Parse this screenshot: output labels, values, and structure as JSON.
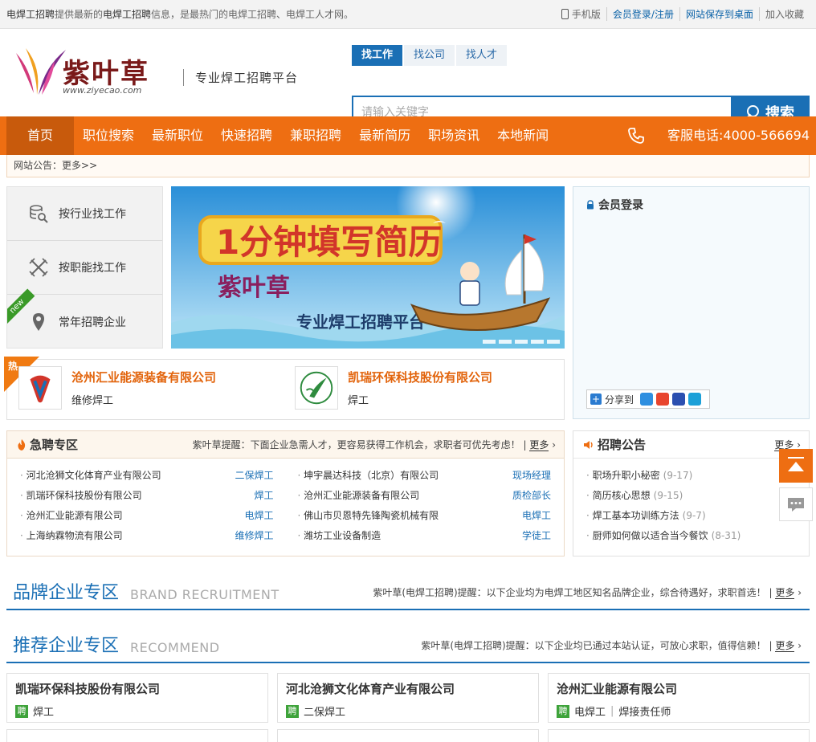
{
  "topbar": {
    "intro_bold1": "电焊工招聘",
    "intro_mid": "提供最新的",
    "intro_bold2": "电焊工招聘",
    "intro_rest": "信息，是最热门的电焊工招聘、电焊工人才网。",
    "mobile": "手机版",
    "login": "会员登录/注册",
    "save_desktop": "网站保存到桌面",
    "favorite": "加入收藏"
  },
  "header": {
    "logo_text": "紫叶草",
    "logo_url": "www.ziyecao.com",
    "slogan": "专业焊工招聘平台",
    "search_tabs": [
      "找工作",
      "找公司",
      "找人才"
    ],
    "search_placeholder": "请输入关键字",
    "search_button": "搜索"
  },
  "nav": {
    "items": [
      "首页",
      "职位搜索",
      "最新职位",
      "快速招聘",
      "兼职招聘",
      "最新简历",
      "职场资讯",
      "本地新闻"
    ],
    "hotline": "客服电话:4000-566694"
  },
  "notice": {
    "label": "网站公告：",
    "more": "更多>>"
  },
  "sidemenu": {
    "items": [
      "按行业找工作",
      "按职能找工作",
      "常年招聘企业"
    ],
    "new_label": "new"
  },
  "banner": {
    "headline": "1分钟填写简历",
    "brand": "紫叶草",
    "sub": "专业焊工招聘平台"
  },
  "login_box": {
    "title": "会员登录",
    "share": "分享到"
  },
  "hot": {
    "flag": "热",
    "companies": [
      {
        "name": "沧州汇业能源装备有限公司",
        "job": "维修焊工"
      },
      {
        "name": "凯瑞环保科技股份有限公司",
        "job": "焊工"
      }
    ]
  },
  "urgent": {
    "title": "急聘专区",
    "tip": "紫叶草提醒：下面企业急需人才，更容易获得工作机会，求职者可优先考虑！",
    "more": "更多",
    "left": [
      {
        "company": "河北沧狮文化体育产业有限公司",
        "job": "二保焊工"
      },
      {
        "company": "凯瑞环保科技股份有限公司",
        "job": "焊工"
      },
      {
        "company": "沧州汇业能源有限公司",
        "job": "电焊工"
      },
      {
        "company": "上海纳霖物流有限公司",
        "job": "维修焊工"
      }
    ],
    "right": [
      {
        "company": "坤宇晨达科技（北京）有限公司",
        "job": "现场经理"
      },
      {
        "company": "沧州汇业能源装备有限公司",
        "job": "质检部长"
      },
      {
        "company": "佛山市贝恩特先锋陶瓷机械有限",
        "job": "电焊工"
      },
      {
        "company": "潍坊工业设备制造",
        "job": "学徒工"
      }
    ]
  },
  "rnotice": {
    "title": "招聘公告",
    "more": "更多",
    "items": [
      {
        "title": "职场升职小秘密",
        "date": "(9-17)"
      },
      {
        "title": "简历核心思想",
        "date": "(9-15)"
      },
      {
        "title": "焊工基本功训练方法",
        "date": "(9-7)"
      },
      {
        "title": "厨师如何做以适合当今餐饮",
        "date": "(8-31)"
      }
    ]
  },
  "brand_section": {
    "cn": "品牌企业专区",
    "en": "BRAND RECRUITMENT",
    "tip": "紫叶草(电焊工招聘)提醒：以下企业均为电焊工地区知名品牌企业，综合待遇好，求职首选！",
    "more": "更多"
  },
  "recommend_section": {
    "cn": "推荐企业专区",
    "en": "RECOMMEND",
    "tip": "紫叶草(电焊工招聘)提醒：以下企业均已通过本站认证，可放心求职，值得信赖！",
    "more": "更多"
  },
  "recommend": {
    "pin": "聘",
    "cards": [
      {
        "name": "凯瑞环保科技股份有限公司",
        "jobs": [
          "焊工"
        ]
      },
      {
        "name": "河北沧狮文化体育产业有限公司",
        "jobs": [
          "二保焊工"
        ]
      },
      {
        "name": "沧州汇业能源有限公司",
        "jobs": [
          "电焊工",
          "焊接责任师"
        ]
      }
    ]
  }
}
